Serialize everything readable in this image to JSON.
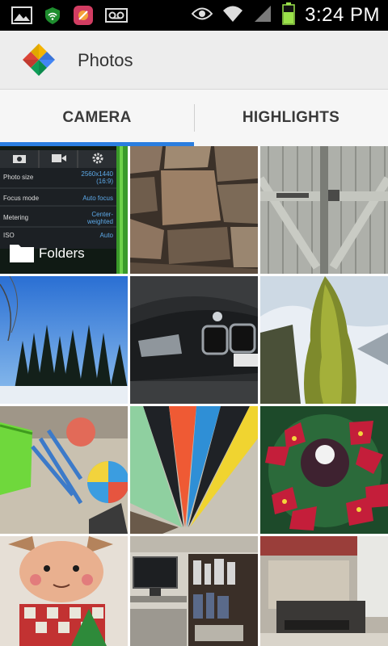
{
  "status_bar": {
    "time": "3:24 PM",
    "icons": [
      "gallery-icon",
      "wifi-shield-icon",
      "app-notification-icon",
      "voicemail-icon",
      "eye-icon",
      "wifi-icon",
      "signal-icon",
      "battery-icon"
    ]
  },
  "app": {
    "title": "Photos"
  },
  "tabs": [
    {
      "label": "CAMERA",
      "selected": true
    },
    {
      "label": "HIGHLIGHTS",
      "selected": false
    }
  ],
  "accent_color": "#2a7ee0",
  "folder_tile": {
    "label": "Folders",
    "settings": [
      {
        "name": "Photo size",
        "value": "2560x1440 (16:9)"
      },
      {
        "name": "Focus mode",
        "value": "Auto focus"
      },
      {
        "name": "Metering",
        "value": "Center-weighted"
      },
      {
        "name": "ISO",
        "value": "Auto"
      }
    ]
  },
  "photos": [
    "stone-wall",
    "barn-door",
    "trees-blue-sky",
    "car-front",
    "evergreen-snow",
    "toys-floor",
    "umbrella",
    "poinsettia-wreath",
    "reindeer-toy",
    "desk-shelves",
    "desk-window"
  ]
}
